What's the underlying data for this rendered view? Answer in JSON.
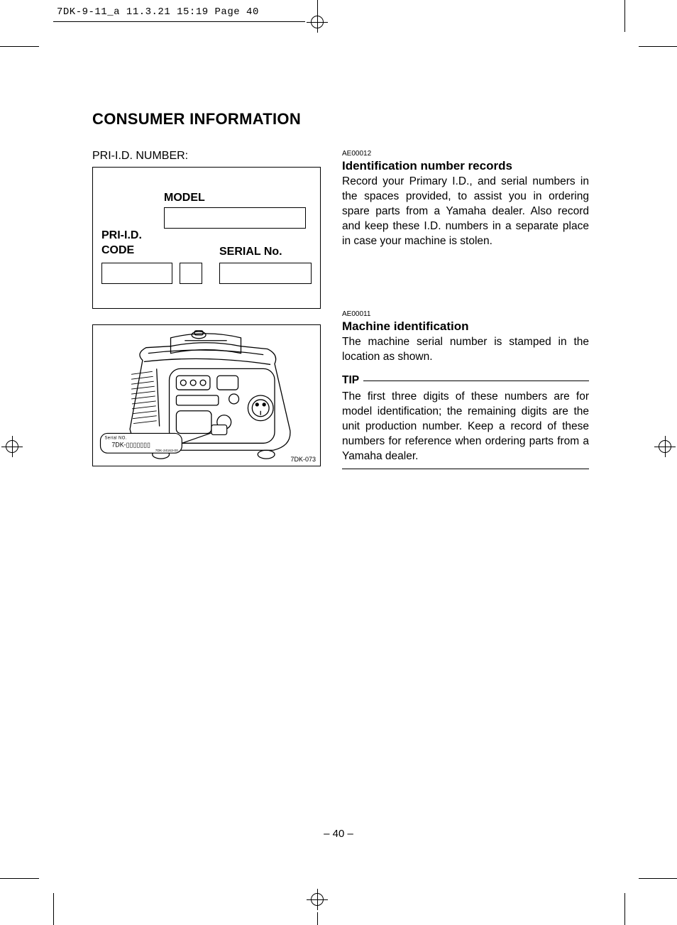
{
  "header": {
    "slug": "7DK-9-11_a  11.3.21 15:19  Page 40"
  },
  "page": {
    "number": "– 40 –"
  },
  "heading": "CONSUMER INFORMATION",
  "left": {
    "pri_label": "PRI-I.D. NUMBER:",
    "form": {
      "model_label": "MODEL",
      "priid_label_line1": "PRI-I.D.",
      "priid_label_line2": "CODE",
      "serial_label": "SERIAL No."
    },
    "diagram": {
      "serial_tag_label": "Serial NO.",
      "serial_tag_text": "7DK-▯▯▯▯▯▯▯",
      "serial_tag_sub": "7DK-24163-00",
      "code": "7DK-073"
    }
  },
  "right": {
    "sec1": {
      "ref": "AE00012",
      "heading": "Identification number records",
      "body": "Record your Primary I.D., and serial numbers in the spaces provided, to assist you in ordering spare parts from a Yamaha dealer. Also record and keep these I.D. numbers in a separate place in case your machine is stolen."
    },
    "sec2": {
      "ref": "AE00011",
      "heading": "Machine identification",
      "body": "The machine serial number is stamped in the location as shown."
    },
    "tip": {
      "label": "TIP",
      "body": "The first three digits of these numbers are for model identification; the remaining digits are the unit production number. Keep a record of these numbers for reference when ordering parts from a Yamaha dealer."
    }
  }
}
